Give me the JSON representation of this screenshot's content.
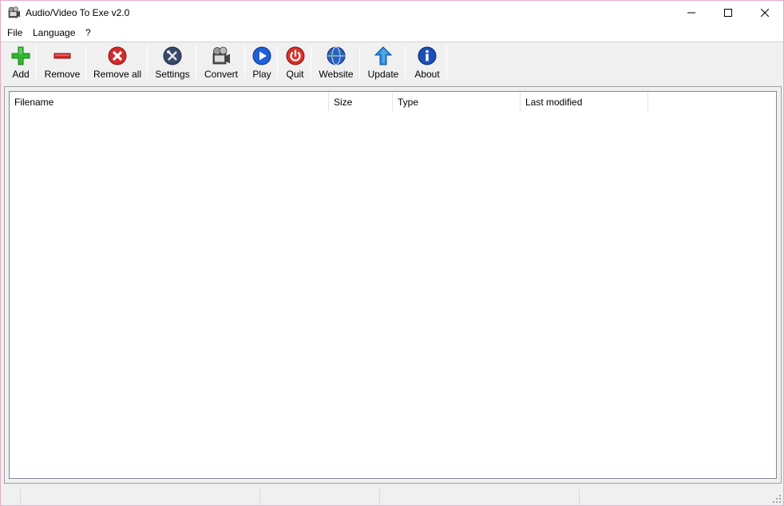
{
  "window": {
    "title": "Audio/Video To Exe v2.0"
  },
  "title_icons": {
    "app": "film-reel-icon",
    "minimize": "minimize-icon",
    "maximize": "maximize-icon",
    "close": "close-icon"
  },
  "menu": {
    "file": "File",
    "language": "Language",
    "help": "?"
  },
  "toolbar": {
    "add": "Add",
    "remove": "Remove",
    "remove_all": "Remove all",
    "settings": "Settings",
    "convert": "Convert",
    "play": "Play",
    "quit": "Quit",
    "website": "Website",
    "update": "Update",
    "about": "About"
  },
  "toolbar_icons": {
    "add": "plus-icon",
    "remove": "minus-icon",
    "remove_all": "remove-all-icon",
    "settings": "tools-icon",
    "convert": "film-reel-icon",
    "play": "play-icon",
    "quit": "power-icon",
    "website": "globe-icon",
    "update": "up-arrow-icon",
    "about": "info-icon"
  },
  "colors": {
    "add": "#2eb82e",
    "remove": "#d42a2a",
    "play": "#1e5fd8",
    "quit": "#d8322a",
    "update": "#2a8fe0",
    "about": "#1e4fb8",
    "window_border": "#e8a8c8"
  },
  "list": {
    "columns": {
      "filename": "Filename",
      "size": "Size",
      "type": "Type",
      "last_modified": "Last modified"
    },
    "rows": []
  }
}
